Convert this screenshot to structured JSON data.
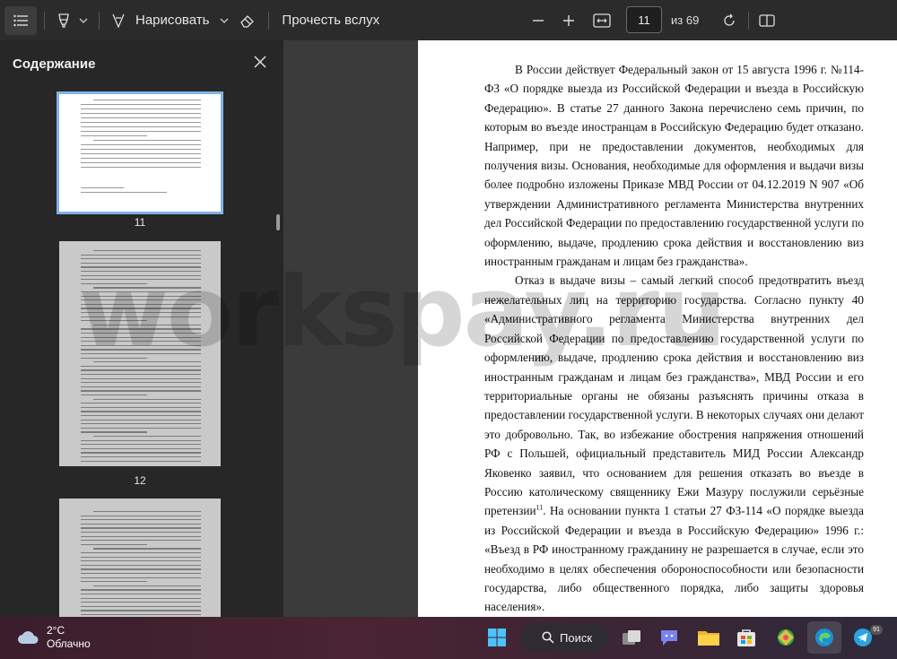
{
  "toolbar": {
    "draw_label": "Нарисовать",
    "read_aloud_label": "Прочесть вслух",
    "page_current": "11",
    "page_total": "из 69"
  },
  "sidebar": {
    "title": "Содержание",
    "thumbs": [
      {
        "number": "11",
        "selected": true
      },
      {
        "number": "12",
        "selected": false
      }
    ]
  },
  "document": {
    "paragraphs": [
      "В России действует Федеральный закон от 15 августа 1996 г. №114-ФЗ «О порядке выезда из Российской Федерации и въезда в Российскую Федерацию». В статье 27 данного Закона перечислено семь причин, по которым во въезде иностранцам в Российскую Федерацию будет отказано. Например, при не предоставлении документов, необходимых для получения визы. Основания, необходимые для оформления и выдачи визы более подробно изложены Приказе МВД России от 04.12.2019 N 907 «Об утверждении Административного регламента Министерства внутренних дел Российской Федерации по предоставлению государственной услуги по оформлению, выдаче, продлению срока действия и восстановлению виз иностранным гражданам и лицам без гражданства».",
      "Отказ в выдаче визы – самый легкий способ предотвратить въезд нежелательных лиц на территорию государства. Согласно пункту 40 «Административного регламента Министерства внутренних дел Российской Федерации по предоставлению государственной услуги по оформлению, выдаче, продлению срока действия и восстановлению виз иностранным гражданам и лицам без гражданства», МВД России и его территориальные органы не обязаны разъяснять причины отказа в предоставлении государственной услуги. В некоторых случаях они делают это добровольно. Так, во избежание обострения напряжения отношений РФ с Польшей, официальный представитель МИД России Александр Яковенко заявил, что основанием для решения отказать во въезде в Россию католическому священнику Ежи Мазуру послужили серьёзные претензии"
    ],
    "footnote_ref": "11",
    "paragraph2_tail": ". На основании пункта 1 статьи 27 ФЗ-114 «О порядке выезда из Российской Федерации и въезда в Российскую Федерацию» 1996 г.: «Въезд в РФ иностранному гражданину не разрешается в случае, если это необходимо в целях обеспечения обороноспособности или безопасности государства, либо общественного порядка, либо защиты здоровья населения»."
  },
  "watermark": "workspay.ru",
  "taskbar": {
    "temperature": "2°C",
    "condition": "Облачно",
    "search_label": "Поиск",
    "telegram_badge": "91"
  }
}
